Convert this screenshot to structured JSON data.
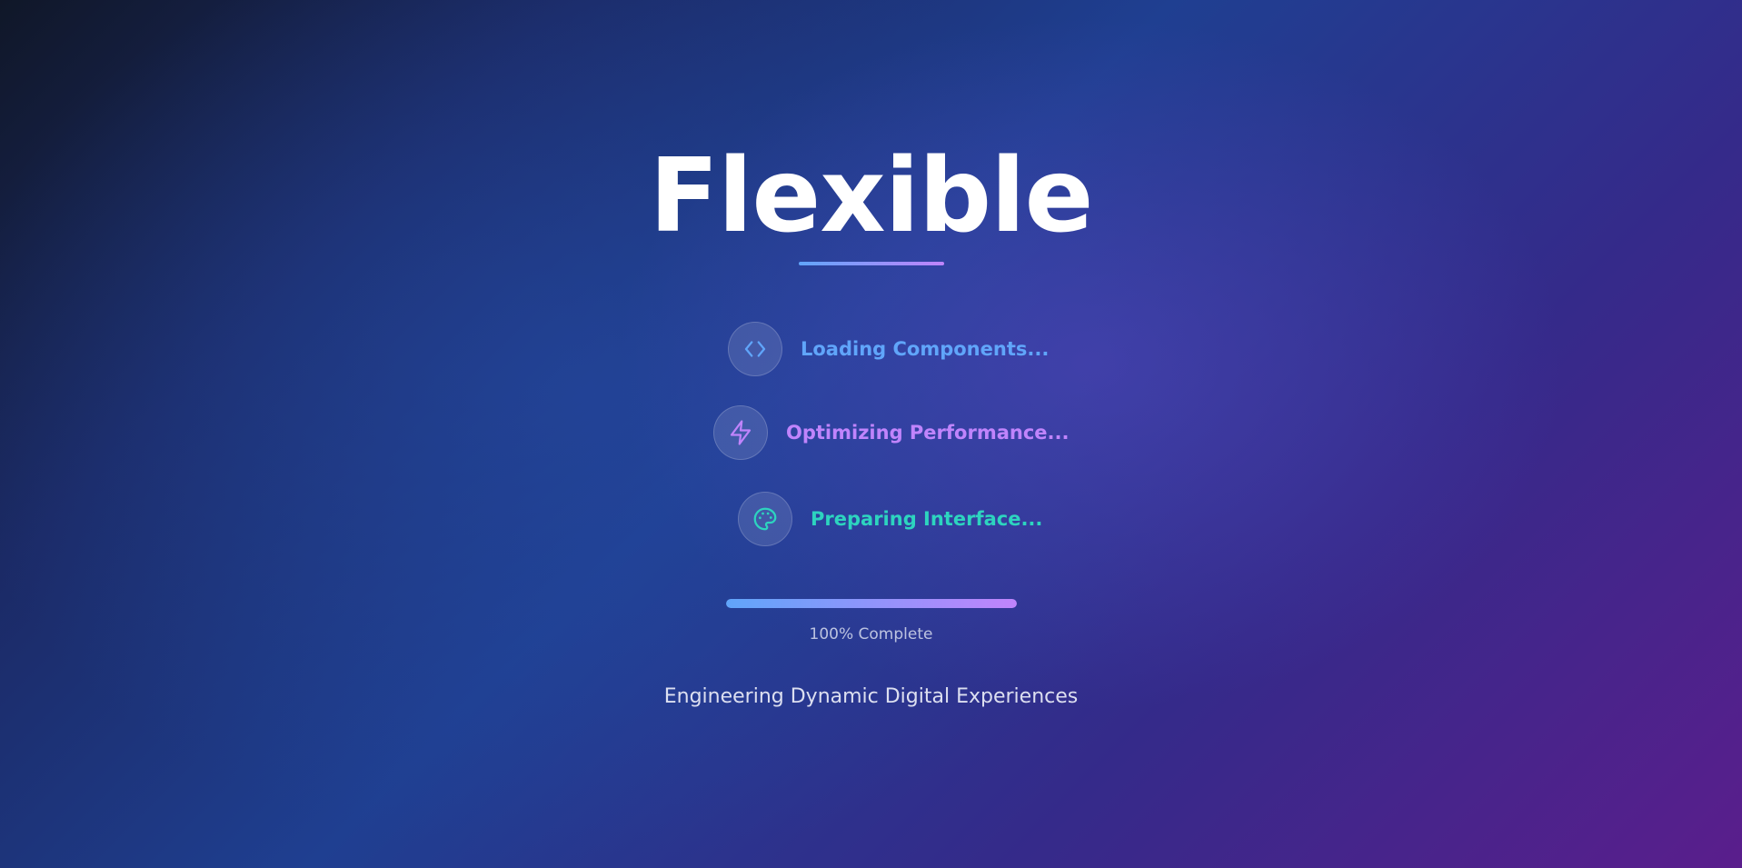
{
  "brand": {
    "title": "Flexible",
    "underline_gradient": [
      "#60a5fa",
      "#c084fc"
    ]
  },
  "steps": [
    {
      "label": "Loading Components...",
      "icon": "code-brackets-icon",
      "color": "#60a5fa"
    },
    {
      "label": "Optimizing Performance...",
      "icon": "lightning-bolt-icon",
      "color": "#c084fc"
    },
    {
      "label": "Preparing Interface...",
      "icon": "palette-icon",
      "color": "#2dd4bf"
    }
  ],
  "progress": {
    "percent": 100,
    "text": "100% Complete",
    "gradient": [
      "#60a5fa",
      "#c084fc"
    ]
  },
  "tagline": "Engineering Dynamic Digital Experiences"
}
